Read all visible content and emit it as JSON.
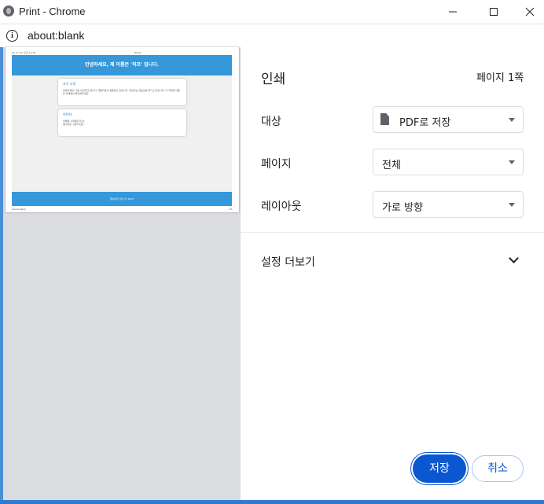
{
  "window": {
    "title": "Print - Chrome",
    "address": "about:blank"
  },
  "preview": {
    "header_left": "26. 8. 10. 오후 11:24",
    "header_right": "Blank",
    "banner": "안녕하세요, 제 이름은 '하프' 입니다.",
    "card1_title": "자기 소개",
    "card1_text": "안녕하세요! 저는 하프라고 합니다. 개발자로서 활동하고 있습니다. 하프라는 컨텐츠를 즐기고 있습니다. 더 자세한 내용은 아래에서 확인해주세요.",
    "card2_title": "연락처",
    "card2_line1": "이메일: [이메일 주소]",
    "card2_line2": "웹사이트: [웹사이트]",
    "footer": "웹사이트 하프 © 2023",
    "footer_left": "about:blank",
    "footer_right": "1/1"
  },
  "panel": {
    "title": "인쇄",
    "page_count": "페이지 1쪽",
    "destination_label": "대상",
    "destination_value": "PDF로 저장",
    "pages_label": "페이지",
    "pages_value": "전체",
    "layout_label": "레이아웃",
    "layout_value": "가로 방향",
    "more_settings": "설정 더보기",
    "save_button": "저장",
    "cancel_button": "취소"
  },
  "colors": {
    "accent": "#0b57d0",
    "preview_banner": "#3498db"
  }
}
